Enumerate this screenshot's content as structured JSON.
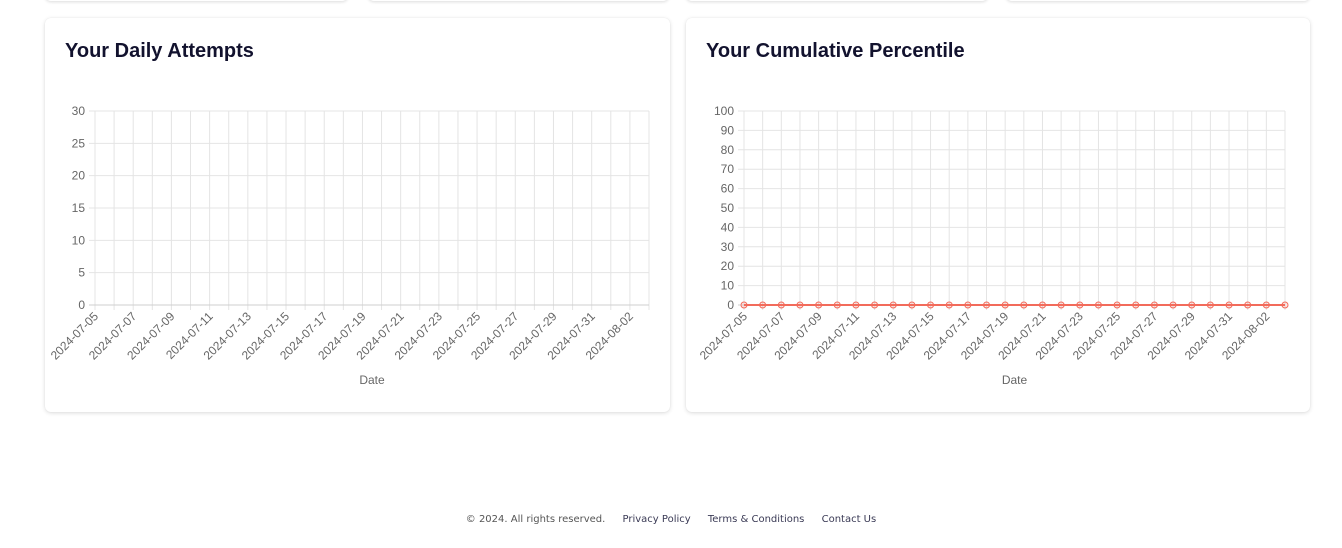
{
  "cards": [
    {
      "title": "Your Daily Attempts",
      "chart_data": {
        "type": "line",
        "title": "Your Daily Attempts",
        "xlabel": "Date",
        "ylabel": "",
        "ylim": [
          0,
          30
        ],
        "yticks": [
          0,
          5,
          10,
          15,
          20,
          25,
          30
        ],
        "grid": true,
        "x": [
          "2024-07-05",
          "2024-07-06",
          "2024-07-07",
          "2024-07-08",
          "2024-07-09",
          "2024-07-10",
          "2024-07-11",
          "2024-07-12",
          "2024-07-13",
          "2024-07-14",
          "2024-07-15",
          "2024-07-16",
          "2024-07-17",
          "2024-07-18",
          "2024-07-19",
          "2024-07-20",
          "2024-07-21",
          "2024-07-22",
          "2024-07-23",
          "2024-07-24",
          "2024-07-25",
          "2024-07-26",
          "2024-07-27",
          "2024-07-28",
          "2024-07-29",
          "2024-07-30",
          "2024-07-31",
          "2024-08-01",
          "2024-08-02",
          "2024-08-03"
        ],
        "xtick_labels": [
          "2024-07-05",
          "2024-07-07",
          "2024-07-09",
          "2024-07-11",
          "2024-07-13",
          "2024-07-15",
          "2024-07-17",
          "2024-07-19",
          "2024-07-21",
          "2024-07-23",
          "2024-07-25",
          "2024-07-27",
          "2024-07-29",
          "2024-07-31",
          "2024-08-02"
        ],
        "series": []
      }
    },
    {
      "title": "Your Cumulative Percentile",
      "chart_data": {
        "type": "line",
        "title": "Your Cumulative Percentile",
        "xlabel": "Date",
        "ylabel": "",
        "ylim": [
          0,
          100
        ],
        "yticks": [
          0,
          10,
          20,
          30,
          40,
          50,
          60,
          70,
          80,
          90,
          100
        ],
        "grid": true,
        "x": [
          "2024-07-05",
          "2024-07-06",
          "2024-07-07",
          "2024-07-08",
          "2024-07-09",
          "2024-07-10",
          "2024-07-11",
          "2024-07-12",
          "2024-07-13",
          "2024-07-14",
          "2024-07-15",
          "2024-07-16",
          "2024-07-17",
          "2024-07-18",
          "2024-07-19",
          "2024-07-20",
          "2024-07-21",
          "2024-07-22",
          "2024-07-23",
          "2024-07-24",
          "2024-07-25",
          "2024-07-26",
          "2024-07-27",
          "2024-07-28",
          "2024-07-29",
          "2024-07-30",
          "2024-07-31",
          "2024-08-01",
          "2024-08-02",
          "2024-08-03"
        ],
        "xtick_labels": [
          "2024-07-05",
          "2024-07-07",
          "2024-07-09",
          "2024-07-11",
          "2024-07-13",
          "2024-07-15",
          "2024-07-17",
          "2024-07-19",
          "2024-07-21",
          "2024-07-23",
          "2024-07-25",
          "2024-07-27",
          "2024-07-29",
          "2024-07-31",
          "2024-08-02"
        ],
        "series": [
          {
            "color": "#f26b5b",
            "values": [
              0,
              0,
              0,
              0,
              0,
              0,
              0,
              0,
              0,
              0,
              0,
              0,
              0,
              0,
              0,
              0,
              0,
              0,
              0,
              0,
              0,
              0,
              0,
              0,
              0,
              0,
              0,
              0,
              0,
              0
            ]
          }
        ]
      }
    }
  ],
  "footer": {
    "copyright": "© 2024. All rights reserved.",
    "privacy": "Privacy Policy",
    "terms": "Terms & Conditions",
    "contact": "Contact Us"
  }
}
